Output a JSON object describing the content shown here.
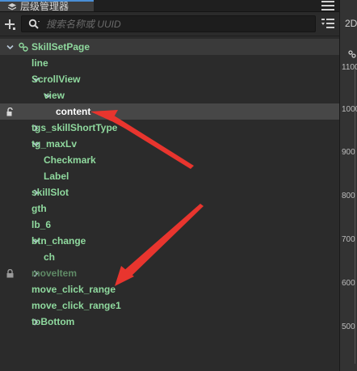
{
  "panel": {
    "title": "层级管理器",
    "menu_icon": "hamburger-menu-icon"
  },
  "toolbar": {
    "add_icon": "plus-icon",
    "search_icon": "search-icon",
    "search_placeholder": "搜索名称或 UUID",
    "sort_icon": "sort-list-icon"
  },
  "tree": [
    {
      "label": "SkillSetPage",
      "depth": 0,
      "expand": "open",
      "root": true,
      "node_icon": "scene-node-icon"
    },
    {
      "label": "line",
      "depth": 1,
      "expand": "none"
    },
    {
      "label": "ScrollView",
      "depth": 1,
      "expand": "open"
    },
    {
      "label": "view",
      "depth": 2,
      "expand": "open"
    },
    {
      "label": "content",
      "depth": 3,
      "expand": "none",
      "selected": true,
      "locked": true
    },
    {
      "label": "tgs_skillShortType",
      "depth": 1,
      "expand": "closed"
    },
    {
      "label": "tg_maxLv",
      "depth": 1,
      "expand": "open"
    },
    {
      "label": "Checkmark",
      "depth": 2,
      "expand": "none"
    },
    {
      "label": "Label",
      "depth": 2,
      "expand": "none"
    },
    {
      "label": "skillSlot",
      "depth": 1,
      "expand": "closed"
    },
    {
      "label": "gth",
      "depth": 1,
      "expand": "none"
    },
    {
      "label": "lb_6",
      "depth": 1,
      "expand": "none"
    },
    {
      "label": "btn_change",
      "depth": 1,
      "expand": "open"
    },
    {
      "label": "ch",
      "depth": 2,
      "expand": "none"
    },
    {
      "label": "moveItem",
      "depth": 1,
      "expand": "closed",
      "locked": true,
      "inactive": true
    },
    {
      "label": "move_click_range",
      "depth": 1,
      "expand": "none"
    },
    {
      "label": "move_click_range1",
      "depth": 1,
      "expand": "none"
    },
    {
      "label": "toBottom",
      "depth": 1,
      "expand": "closed"
    }
  ],
  "scene": {
    "mode_label": "2D",
    "ruler_labels": [
      "1100",
      "1000",
      "900",
      "800",
      "700",
      "600",
      "500"
    ]
  },
  "colors": {
    "node_text": "#8fd99e",
    "selected_text": "#ffffff",
    "annotation_arrow": "#e8352e"
  }
}
